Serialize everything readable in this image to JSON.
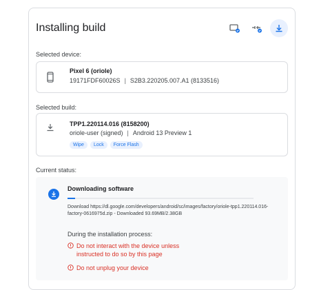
{
  "header": {
    "title": "Installing build"
  },
  "labels": {
    "selected_device": "Selected device:",
    "selected_build": "Selected build:",
    "current_status": "Current status:"
  },
  "device": {
    "name": "Pixel 6 (oriole)",
    "serial": "19171FDF60026S",
    "separator": "|",
    "build": "S2B3.220205.007.A1 (8133516)"
  },
  "build": {
    "id": "TPP1.220114.016 (8158200)",
    "variant": "oriole-user (signed)",
    "separator": "|",
    "release": "Android 13 Preview 1",
    "options": [
      "Wipe",
      "Lock",
      "Force Flash"
    ]
  },
  "status": {
    "title": "Downloading software",
    "progress": 0.04,
    "detail": "Download https://dl.google.com/developers/android/sc/images/factory/oriole-tpp1.220114.016-factory-0616975d.zip - Downloaded 93.69MB/2.38GB",
    "during": "During the installation process:",
    "warnings": [
      "Do not interact with the device unless instructed to do so by this page",
      "Do not unplug your device"
    ]
  },
  "colors": {
    "accent": "#1a73e8",
    "warning": "#d93025",
    "border": "#dadce0"
  }
}
